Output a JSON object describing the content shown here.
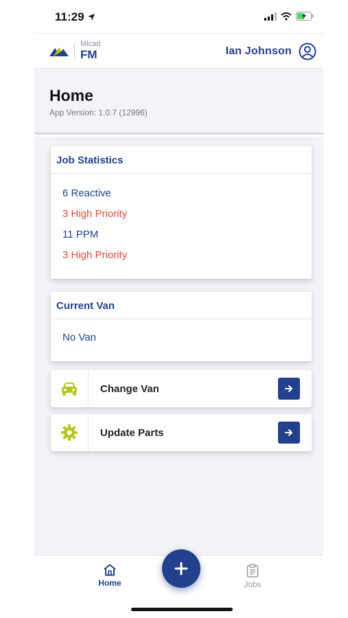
{
  "status_bar": {
    "time": "11:29"
  },
  "header": {
    "logo_sub": "Micad",
    "logo_main": "FM",
    "user_name": "Ian Johnson"
  },
  "page": {
    "title": "Home",
    "version": "App Version: 1.0.7 (12996)"
  },
  "job_statistics": {
    "title": "Job Statistics",
    "lines": [
      {
        "text": "6 Reactive",
        "color": "#23408e"
      },
      {
        "text": "3 High Priority",
        "color": "#e04a3c"
      },
      {
        "text": "11 PPM",
        "color": "#23408e"
      },
      {
        "text": "3 High Priority",
        "color": "#e04a3c"
      }
    ]
  },
  "current_van": {
    "title": "Current Van",
    "value": "No Van"
  },
  "actions": [
    {
      "label": "Change Van",
      "icon": "car-icon"
    },
    {
      "label": "Update Parts",
      "icon": "gear-icon"
    }
  ],
  "bottom_nav": {
    "home_label": "Home",
    "jobs_label": "Jobs"
  },
  "colors": {
    "brand": "#23408e",
    "accent_lime": "#b5c81f",
    "alert": "#e04a3c"
  }
}
